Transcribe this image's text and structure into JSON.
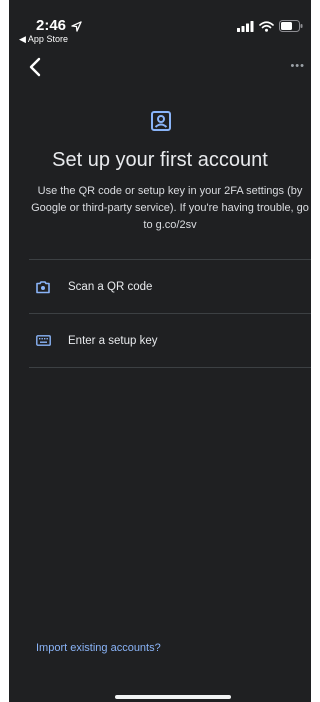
{
  "status_bar": {
    "time": "2:46",
    "back_app": "◀ App Store"
  },
  "header": {
    "more_glyph": "•••"
  },
  "main": {
    "title": "Set up your first account",
    "subtitle": "Use the QR code or setup key in your 2FA settings (by Google or third-party service). If you're having trouble, go to g.co/2sv"
  },
  "options": [
    {
      "label": "Scan a QR code",
      "icon": "camera-icon"
    },
    {
      "label": "Enter a setup key",
      "icon": "keyboard-icon"
    }
  ],
  "footer": {
    "import_label": "Import existing accounts?"
  },
  "colors": {
    "background": "#1f2022",
    "accent": "#8ab4f8",
    "text": "#e8eaed"
  }
}
